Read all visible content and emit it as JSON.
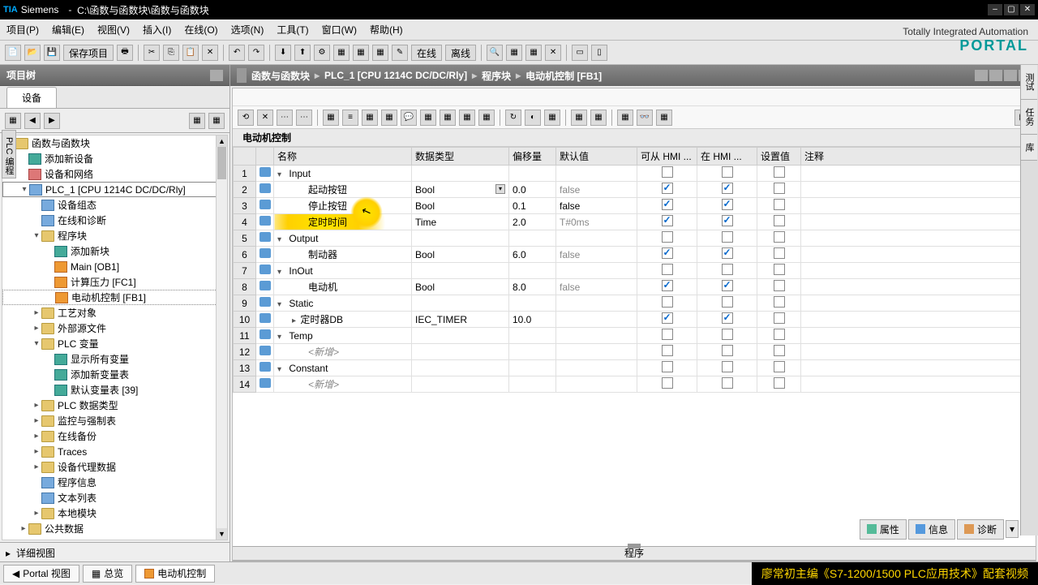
{
  "titlebar": {
    "logo": "TIA",
    "brand": "Siemens",
    "path": "C:\\函数与函数块\\函数与函数块"
  },
  "menu": [
    "项目(P)",
    "编辑(E)",
    "视图(V)",
    "插入(I)",
    "在线(O)",
    "选项(N)",
    "工具(T)",
    "窗口(W)",
    "帮助(H)"
  ],
  "portal": {
    "line1": "Totally Integrated Automation",
    "line2": "PORTAL"
  },
  "toolbar": {
    "save": "保存项目",
    "online": "在线",
    "offline": "离线"
  },
  "sidebar": {
    "header": "项目树",
    "tab": "设备",
    "left_tab": "PLC 编程",
    "detail": "详细视图",
    "tree": [
      {
        "indent": 0,
        "exp": "▾",
        "icon": "ti-folder",
        "label": "函数与函数块"
      },
      {
        "indent": 1,
        "exp": "",
        "icon": "ti-green",
        "label": "添加新设备"
      },
      {
        "indent": 1,
        "exp": "",
        "icon": "ti-pink",
        "label": "设备和网络"
      },
      {
        "indent": 1,
        "exp": "▾",
        "icon": "ti-blue",
        "label": "PLC_1 [CPU 1214C DC/DC/Rly]",
        "boxed": true
      },
      {
        "indent": 2,
        "exp": "",
        "icon": "ti-blue",
        "label": "设备组态"
      },
      {
        "indent": 2,
        "exp": "",
        "icon": "ti-blue",
        "label": "在线和诊断"
      },
      {
        "indent": 2,
        "exp": "▾",
        "icon": "ti-folder",
        "label": "程序块"
      },
      {
        "indent": 3,
        "exp": "",
        "icon": "ti-green",
        "label": "添加新块"
      },
      {
        "indent": 3,
        "exp": "",
        "icon": "ti-orange",
        "label": "Main [OB1]"
      },
      {
        "indent": 3,
        "exp": "",
        "icon": "ti-orange",
        "label": "计算压力 [FC1]"
      },
      {
        "indent": 3,
        "exp": "",
        "icon": "ti-orange",
        "label": "电动机控制 [FB1]",
        "selected": true
      },
      {
        "indent": 2,
        "exp": "▸",
        "icon": "ti-folder",
        "label": "工艺对象"
      },
      {
        "indent": 2,
        "exp": "▸",
        "icon": "ti-folder",
        "label": "外部源文件"
      },
      {
        "indent": 2,
        "exp": "▾",
        "icon": "ti-folder",
        "label": "PLC 变量"
      },
      {
        "indent": 3,
        "exp": "",
        "icon": "ti-green",
        "label": "显示所有变量"
      },
      {
        "indent": 3,
        "exp": "",
        "icon": "ti-green",
        "label": "添加新变量表"
      },
      {
        "indent": 3,
        "exp": "",
        "icon": "ti-green",
        "label": "默认变量表 [39]"
      },
      {
        "indent": 2,
        "exp": "▸",
        "icon": "ti-folder",
        "label": "PLC 数据类型"
      },
      {
        "indent": 2,
        "exp": "▸",
        "icon": "ti-folder",
        "label": "监控与强制表"
      },
      {
        "indent": 2,
        "exp": "▸",
        "icon": "ti-folder",
        "label": "在线备份"
      },
      {
        "indent": 2,
        "exp": "▸",
        "icon": "ti-folder",
        "label": "Traces"
      },
      {
        "indent": 2,
        "exp": "▸",
        "icon": "ti-folder",
        "label": "设备代理数据"
      },
      {
        "indent": 2,
        "exp": "",
        "icon": "ti-blue",
        "label": "程序信息"
      },
      {
        "indent": 2,
        "exp": "",
        "icon": "ti-blue",
        "label": "文本列表"
      },
      {
        "indent": 2,
        "exp": "▸",
        "icon": "ti-folder",
        "label": "本地模块"
      },
      {
        "indent": 1,
        "exp": "▸",
        "icon": "ti-folder",
        "label": "公共数据"
      }
    ]
  },
  "breadcrumb": [
    "函数与函数块",
    "PLC_1 [CPU 1214C DC/DC/Rly]",
    "程序块",
    "电动机控制 [FB1]"
  ],
  "block_title": "电动机控制",
  "grid": {
    "headers": [
      "",
      "",
      "名称",
      "数据类型",
      "偏移量",
      "默认值",
      "可从 HMI ...",
      "在 HMI ...",
      "设置值",
      "注释"
    ],
    "rows": [
      {
        "num": 1,
        "section": true,
        "name": "Input",
        "caret": "▾",
        "c1": false,
        "c2": false,
        "c3": false
      },
      {
        "num": 2,
        "name": "起动按钮",
        "type": "Bool",
        "type_dd": true,
        "offset": "0.0",
        "default": "false",
        "gray": true,
        "c1": true,
        "c2": true,
        "c3": false
      },
      {
        "num": 3,
        "name": "停止按钮",
        "type": "Bool",
        "offset": "0.1",
        "default": "false",
        "c1": true,
        "c2": true,
        "c3": false
      },
      {
        "num": 4,
        "name": "定时时间",
        "type": "Time",
        "offset": "2.0",
        "default": "T#0ms",
        "gray": true,
        "c1": true,
        "c2": true,
        "c3": false,
        "hl": true
      },
      {
        "num": 5,
        "section": true,
        "name": "Output",
        "caret": "▾",
        "c1": false,
        "c2": false,
        "c3": false
      },
      {
        "num": 6,
        "name": "制动器",
        "type": "Bool",
        "offset": "6.0",
        "default": "false",
        "gray": true,
        "c1": true,
        "c2": true,
        "c3": false
      },
      {
        "num": 7,
        "section": true,
        "name": "InOut",
        "caret": "▾",
        "c1": false,
        "c2": false,
        "c3": false
      },
      {
        "num": 8,
        "name": "电动机",
        "type": "Bool",
        "offset": "8.0",
        "default": "false",
        "gray": true,
        "c1": true,
        "c2": true,
        "c3": false
      },
      {
        "num": 9,
        "section": true,
        "name": "Static",
        "caret": "▾",
        "c1": false,
        "c2": false,
        "c3": false
      },
      {
        "num": 10,
        "subcaret": "▸",
        "name": "定时器DB",
        "type": "IEC_TIMER",
        "offset": "10.0",
        "default": "",
        "c1": true,
        "c2": true,
        "c3": false
      },
      {
        "num": 11,
        "section": true,
        "name": "Temp",
        "caret": "▾",
        "c1": false,
        "c2": false,
        "c3": false
      },
      {
        "num": 12,
        "addnew": true,
        "name": "<新增>",
        "c1": false,
        "c2": false,
        "c3": false
      },
      {
        "num": 13,
        "section": true,
        "name": "Constant",
        "caret": "▾",
        "c1": false,
        "c2": false,
        "c3": false
      },
      {
        "num": 14,
        "addnew": true,
        "name": "<新增>",
        "c1": false,
        "c2": false,
        "c3": false
      }
    ],
    "divider": "程序"
  },
  "bottom": {
    "props": "属性",
    "info": "信息",
    "diag": "诊断"
  },
  "right_tabs": [
    "测试",
    "任务",
    "库"
  ],
  "status": {
    "portal": "Portal 视图",
    "overview": "总览",
    "active": "电动机控制",
    "ad": "廖常初主编《S7-1200/1500 PLC应用技术》配套视频"
  }
}
